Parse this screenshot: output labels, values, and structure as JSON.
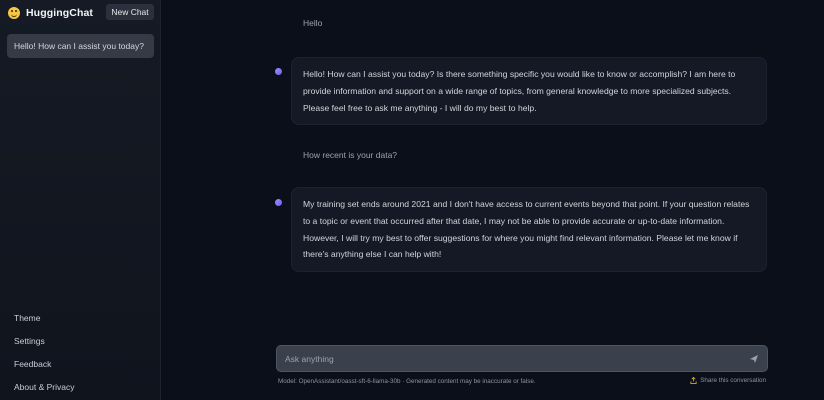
{
  "sidebar": {
    "brand_name": "HuggingChat",
    "brand_icon": "hugging-face-logo",
    "new_chat_label": "New Chat",
    "conversations": [
      {
        "title": "Hello! How can I assist you today?"
      }
    ],
    "footer_links": [
      "Theme",
      "Settings",
      "Feedback",
      "About & Privacy"
    ]
  },
  "chat": {
    "messages": [
      {
        "role": "user",
        "text": "Hello"
      },
      {
        "role": "assistant",
        "text": "Hello! How can I assist you today? Is there something specific you would like to know or accomplish? I am here to provide information and support on a wide range of topics, from general knowledge to more specialized subjects. Please feel free to ask me anything - I will do my best to help."
      },
      {
        "role": "user",
        "text": "How recent is your data?"
      },
      {
        "role": "assistant",
        "text": "My training set ends around 2021 and I don't have access to current events beyond that point. If your question relates to a topic or event that occurred after that date, I may not be able to provide accurate or up-to-date information. However, I will try my best to offer suggestions for where you might find relevant information. Please let me know if there's anything else I can help with!"
      }
    ]
  },
  "composer": {
    "placeholder": "Ask anything",
    "value": "",
    "send_icon": "send-icon"
  },
  "footer": {
    "model_note": "Model: OpenAssistant/oasst-sft-6-llama-30b · Generated content may be inaccurate or false.",
    "share_label": "Share this conversation",
    "share_icon": "share-icon"
  },
  "colors": {
    "background": "#0b0f19",
    "sidebar": "#151a24",
    "accent_dot": "#8b5cf6",
    "input_bg": "#3a414d"
  }
}
